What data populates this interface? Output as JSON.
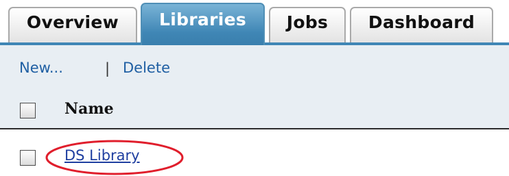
{
  "tabs": [
    {
      "label": "Overview",
      "active": false
    },
    {
      "label": "Libraries",
      "active": true
    },
    {
      "label": "Jobs",
      "active": false
    },
    {
      "label": "Dashboard",
      "active": false
    }
  ],
  "toolbar": {
    "new_label": "New...",
    "separator": "|",
    "delete_label": "Delete"
  },
  "table": {
    "columns": [
      "Name"
    ],
    "rows": [
      {
        "name": "DS Library",
        "selected": false
      }
    ]
  },
  "annotation": {
    "shape": "oval",
    "target": "DS Library",
    "color": "#e01e2c"
  },
  "colors": {
    "active_tab": "#3f86b5",
    "toolbar_bg": "#e8eef3",
    "link": "#1f5fa3"
  }
}
